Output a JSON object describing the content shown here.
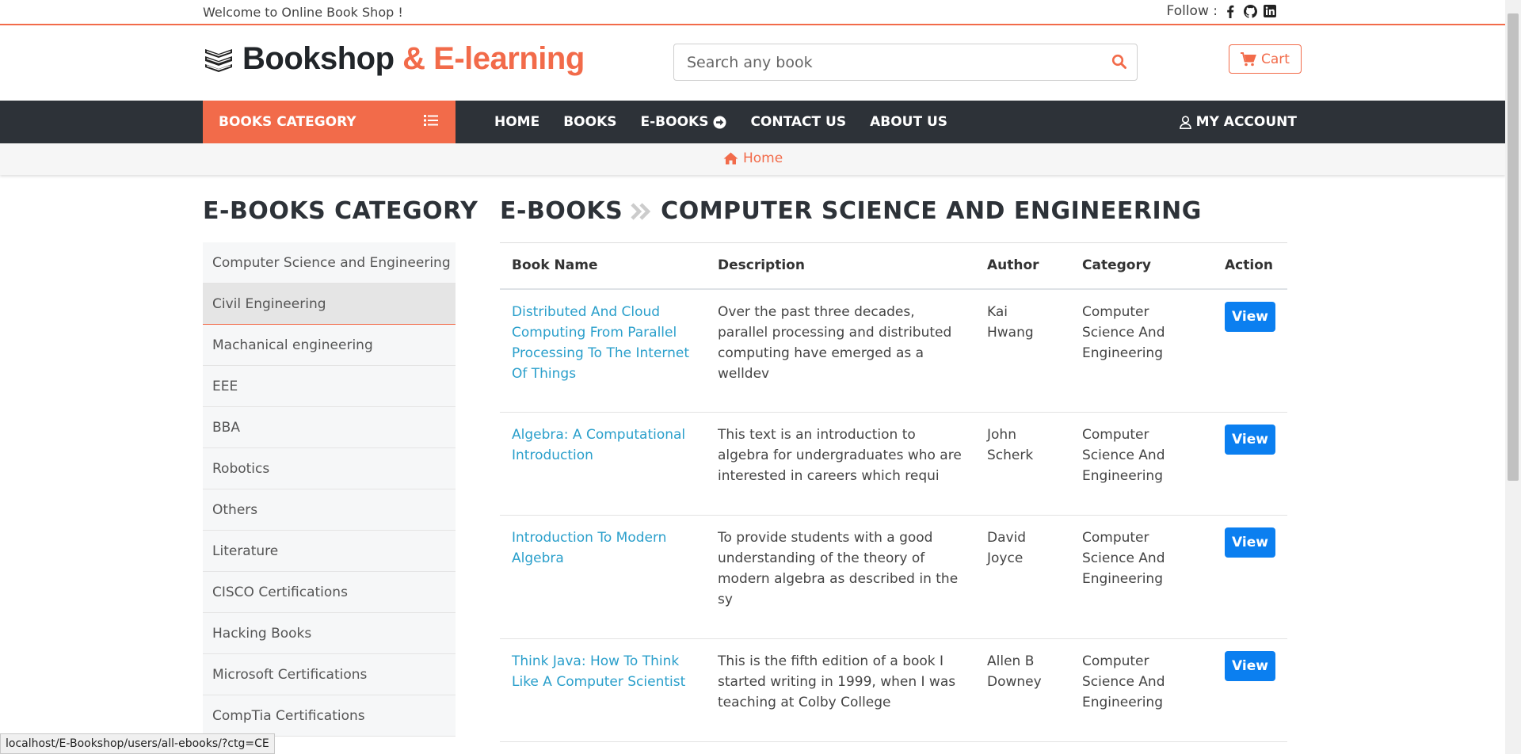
{
  "topbar": {
    "welcome": "Welcome to Online Book Shop !",
    "follow_label": "Follow :",
    "social_icons": [
      "facebook-icon",
      "github-icon",
      "linkedin-icon"
    ]
  },
  "header": {
    "logo_dark": "Bookshop",
    "logo_accent": " & E-learning",
    "search_placeholder": "Search any book",
    "cart_label": "Cart"
  },
  "nav": {
    "category_button": "BOOKS CATEGORY",
    "links": [
      "HOME",
      "BOOKS",
      "E-BOOKS",
      "CONTACT US",
      "ABOUT US"
    ],
    "account": "MY ACCOUNT"
  },
  "breadcrumb": {
    "home": "Home"
  },
  "sidebar": {
    "title": "E-BOOKS CATEGORY",
    "items": [
      "Computer Science and Engineering",
      "Civil Engineering",
      "Machanical engineering",
      "EEE",
      "BBA",
      "Robotics",
      "Others",
      "Literature",
      "CISCO Certifications",
      "Hacking Books",
      "Microsoft Certifications",
      "CompTia Certifications"
    ],
    "active_index": 1
  },
  "main": {
    "title_part1": "E-BOOKS",
    "title_part2": "COMPUTER SCIENCE AND ENGINEERING",
    "columns": [
      "Book Name",
      "Description",
      "Author",
      "Category",
      "Action"
    ],
    "rows": [
      {
        "name": "Distributed And Cloud Computing From Parallel Processing To The Internet Of Things",
        "description": "Over the past three decades, parallel processing and distributed computing have emerged as a welldev",
        "author": "Kai Hwang",
        "category": "Computer Science And Engineering",
        "action": "View"
      },
      {
        "name": "Algebra: A Computational Introduction",
        "description": "This text is an introduction to algebra for undergraduates who are interested in careers which requi",
        "author": "John Scherk",
        "category": "Computer Science And Engineering",
        "action": "View"
      },
      {
        "name": "Introduction To Modern Algebra",
        "description": "To provide students with a good understanding of the theory of modern algebra as described in the sy",
        "author": "David Joyce",
        "category": "Computer Science And Engineering",
        "action": "View"
      },
      {
        "name": "Think Java: How To Think Like A Computer Scientist",
        "description": "This is the fifth edition of a book I started writing in 1999, when I was teaching at Colby College",
        "author": "Allen B Downey",
        "category": "Computer Science And Engineering",
        "action": "View"
      }
    ]
  },
  "status_bar": {
    "url": "localhost/E-Bookshop/users/all-ebooks/?ctg=CE"
  },
  "colors": {
    "accent": "#f26b4a",
    "nav_dark": "#2d3238",
    "link_blue": "#2a9fcb",
    "button_blue": "#0b7ff0"
  }
}
